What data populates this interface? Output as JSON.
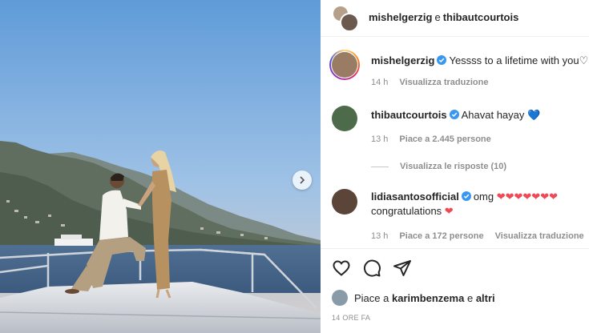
{
  "header": {
    "user1": "mishelgerzig",
    "separator": "e",
    "user2": "thibautcourtois"
  },
  "comments": [
    {
      "user": "mishelgerzig",
      "text": "Yessss to a lifetime with you",
      "time": "14 h",
      "translate": "Visualizza traduzione"
    },
    {
      "user": "thibautcourtois",
      "text": "Ahavat hayay",
      "emoji": "💙",
      "time": "13 h",
      "likes": "Piace a 2.445 persone",
      "replies": "Visualizza le risposte (10)"
    },
    {
      "user": "lidiasantosofficial",
      "text": "omg",
      "emoji": "❤❤❤❤❤❤❤",
      "line2": "congratulations",
      "line2_emoji": "❤",
      "time": "13 h",
      "likes": "Piace a 172 persone",
      "translate": "Visualizza traduzione"
    }
  ],
  "likes": {
    "prefix": "Piace a",
    "user": "karimbenzema",
    "conj": "e",
    "others": "altri"
  },
  "timestamp": "14 ORE FA",
  "colors": {
    "verified": "#3897f0",
    "heart": "#ed4956",
    "muted": "#8e8e8e"
  },
  "icons": [
    "heart-icon",
    "comment-icon",
    "share-icon",
    "verified-icon",
    "chevron-right-icon"
  ]
}
